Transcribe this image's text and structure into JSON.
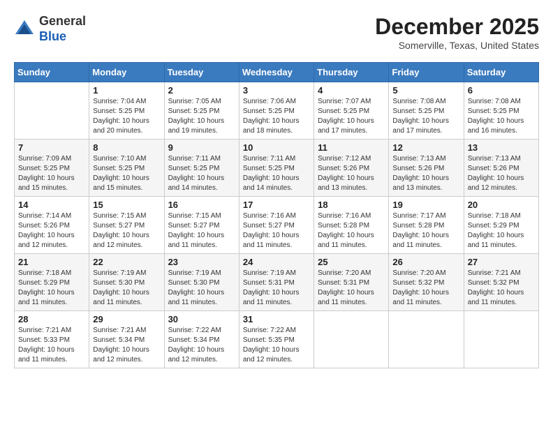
{
  "header": {
    "logo_line1": "General",
    "logo_line2": "Blue",
    "month": "December 2025",
    "location": "Somerville, Texas, United States"
  },
  "days_of_week": [
    "Sunday",
    "Monday",
    "Tuesday",
    "Wednesday",
    "Thursday",
    "Friday",
    "Saturday"
  ],
  "weeks": [
    [
      {
        "day": "",
        "sunrise": "",
        "sunset": "",
        "daylight": ""
      },
      {
        "day": "1",
        "sunrise": "Sunrise: 7:04 AM",
        "sunset": "Sunset: 5:25 PM",
        "daylight": "Daylight: 10 hours and 20 minutes."
      },
      {
        "day": "2",
        "sunrise": "Sunrise: 7:05 AM",
        "sunset": "Sunset: 5:25 PM",
        "daylight": "Daylight: 10 hours and 19 minutes."
      },
      {
        "day": "3",
        "sunrise": "Sunrise: 7:06 AM",
        "sunset": "Sunset: 5:25 PM",
        "daylight": "Daylight: 10 hours and 18 minutes."
      },
      {
        "day": "4",
        "sunrise": "Sunrise: 7:07 AM",
        "sunset": "Sunset: 5:25 PM",
        "daylight": "Daylight: 10 hours and 17 minutes."
      },
      {
        "day": "5",
        "sunrise": "Sunrise: 7:08 AM",
        "sunset": "Sunset: 5:25 PM",
        "daylight": "Daylight: 10 hours and 17 minutes."
      },
      {
        "day": "6",
        "sunrise": "Sunrise: 7:08 AM",
        "sunset": "Sunset: 5:25 PM",
        "daylight": "Daylight: 10 hours and 16 minutes."
      }
    ],
    [
      {
        "day": "7",
        "sunrise": "Sunrise: 7:09 AM",
        "sunset": "Sunset: 5:25 PM",
        "daylight": "Daylight: 10 hours and 15 minutes."
      },
      {
        "day": "8",
        "sunrise": "Sunrise: 7:10 AM",
        "sunset": "Sunset: 5:25 PM",
        "daylight": "Daylight: 10 hours and 15 minutes."
      },
      {
        "day": "9",
        "sunrise": "Sunrise: 7:11 AM",
        "sunset": "Sunset: 5:25 PM",
        "daylight": "Daylight: 10 hours and 14 minutes."
      },
      {
        "day": "10",
        "sunrise": "Sunrise: 7:11 AM",
        "sunset": "Sunset: 5:25 PM",
        "daylight": "Daylight: 10 hours and 14 minutes."
      },
      {
        "day": "11",
        "sunrise": "Sunrise: 7:12 AM",
        "sunset": "Sunset: 5:26 PM",
        "daylight": "Daylight: 10 hours and 13 minutes."
      },
      {
        "day": "12",
        "sunrise": "Sunrise: 7:13 AM",
        "sunset": "Sunset: 5:26 PM",
        "daylight": "Daylight: 10 hours and 13 minutes."
      },
      {
        "day": "13",
        "sunrise": "Sunrise: 7:13 AM",
        "sunset": "Sunset: 5:26 PM",
        "daylight": "Daylight: 10 hours and 12 minutes."
      }
    ],
    [
      {
        "day": "14",
        "sunrise": "Sunrise: 7:14 AM",
        "sunset": "Sunset: 5:26 PM",
        "daylight": "Daylight: 10 hours and 12 minutes."
      },
      {
        "day": "15",
        "sunrise": "Sunrise: 7:15 AM",
        "sunset": "Sunset: 5:27 PM",
        "daylight": "Daylight: 10 hours and 12 minutes."
      },
      {
        "day": "16",
        "sunrise": "Sunrise: 7:15 AM",
        "sunset": "Sunset: 5:27 PM",
        "daylight": "Daylight: 10 hours and 11 minutes."
      },
      {
        "day": "17",
        "sunrise": "Sunrise: 7:16 AM",
        "sunset": "Sunset: 5:27 PM",
        "daylight": "Daylight: 10 hours and 11 minutes."
      },
      {
        "day": "18",
        "sunrise": "Sunrise: 7:16 AM",
        "sunset": "Sunset: 5:28 PM",
        "daylight": "Daylight: 10 hours and 11 minutes."
      },
      {
        "day": "19",
        "sunrise": "Sunrise: 7:17 AM",
        "sunset": "Sunset: 5:28 PM",
        "daylight": "Daylight: 10 hours and 11 minutes."
      },
      {
        "day": "20",
        "sunrise": "Sunrise: 7:18 AM",
        "sunset": "Sunset: 5:29 PM",
        "daylight": "Daylight: 10 hours and 11 minutes."
      }
    ],
    [
      {
        "day": "21",
        "sunrise": "Sunrise: 7:18 AM",
        "sunset": "Sunset: 5:29 PM",
        "daylight": "Daylight: 10 hours and 11 minutes."
      },
      {
        "day": "22",
        "sunrise": "Sunrise: 7:19 AM",
        "sunset": "Sunset: 5:30 PM",
        "daylight": "Daylight: 10 hours and 11 minutes."
      },
      {
        "day": "23",
        "sunrise": "Sunrise: 7:19 AM",
        "sunset": "Sunset: 5:30 PM",
        "daylight": "Daylight: 10 hours and 11 minutes."
      },
      {
        "day": "24",
        "sunrise": "Sunrise: 7:19 AM",
        "sunset": "Sunset: 5:31 PM",
        "daylight": "Daylight: 10 hours and 11 minutes."
      },
      {
        "day": "25",
        "sunrise": "Sunrise: 7:20 AM",
        "sunset": "Sunset: 5:31 PM",
        "daylight": "Daylight: 10 hours and 11 minutes."
      },
      {
        "day": "26",
        "sunrise": "Sunrise: 7:20 AM",
        "sunset": "Sunset: 5:32 PM",
        "daylight": "Daylight: 10 hours and 11 minutes."
      },
      {
        "day": "27",
        "sunrise": "Sunrise: 7:21 AM",
        "sunset": "Sunset: 5:32 PM",
        "daylight": "Daylight: 10 hours and 11 minutes."
      }
    ],
    [
      {
        "day": "28",
        "sunrise": "Sunrise: 7:21 AM",
        "sunset": "Sunset: 5:33 PM",
        "daylight": "Daylight: 10 hours and 11 minutes."
      },
      {
        "day": "29",
        "sunrise": "Sunrise: 7:21 AM",
        "sunset": "Sunset: 5:34 PM",
        "daylight": "Daylight: 10 hours and 12 minutes."
      },
      {
        "day": "30",
        "sunrise": "Sunrise: 7:22 AM",
        "sunset": "Sunset: 5:34 PM",
        "daylight": "Daylight: 10 hours and 12 minutes."
      },
      {
        "day": "31",
        "sunrise": "Sunrise: 7:22 AM",
        "sunset": "Sunset: 5:35 PM",
        "daylight": "Daylight: 10 hours and 12 minutes."
      },
      {
        "day": "",
        "sunrise": "",
        "sunset": "",
        "daylight": ""
      },
      {
        "day": "",
        "sunrise": "",
        "sunset": "",
        "daylight": ""
      },
      {
        "day": "",
        "sunrise": "",
        "sunset": "",
        "daylight": ""
      }
    ]
  ]
}
